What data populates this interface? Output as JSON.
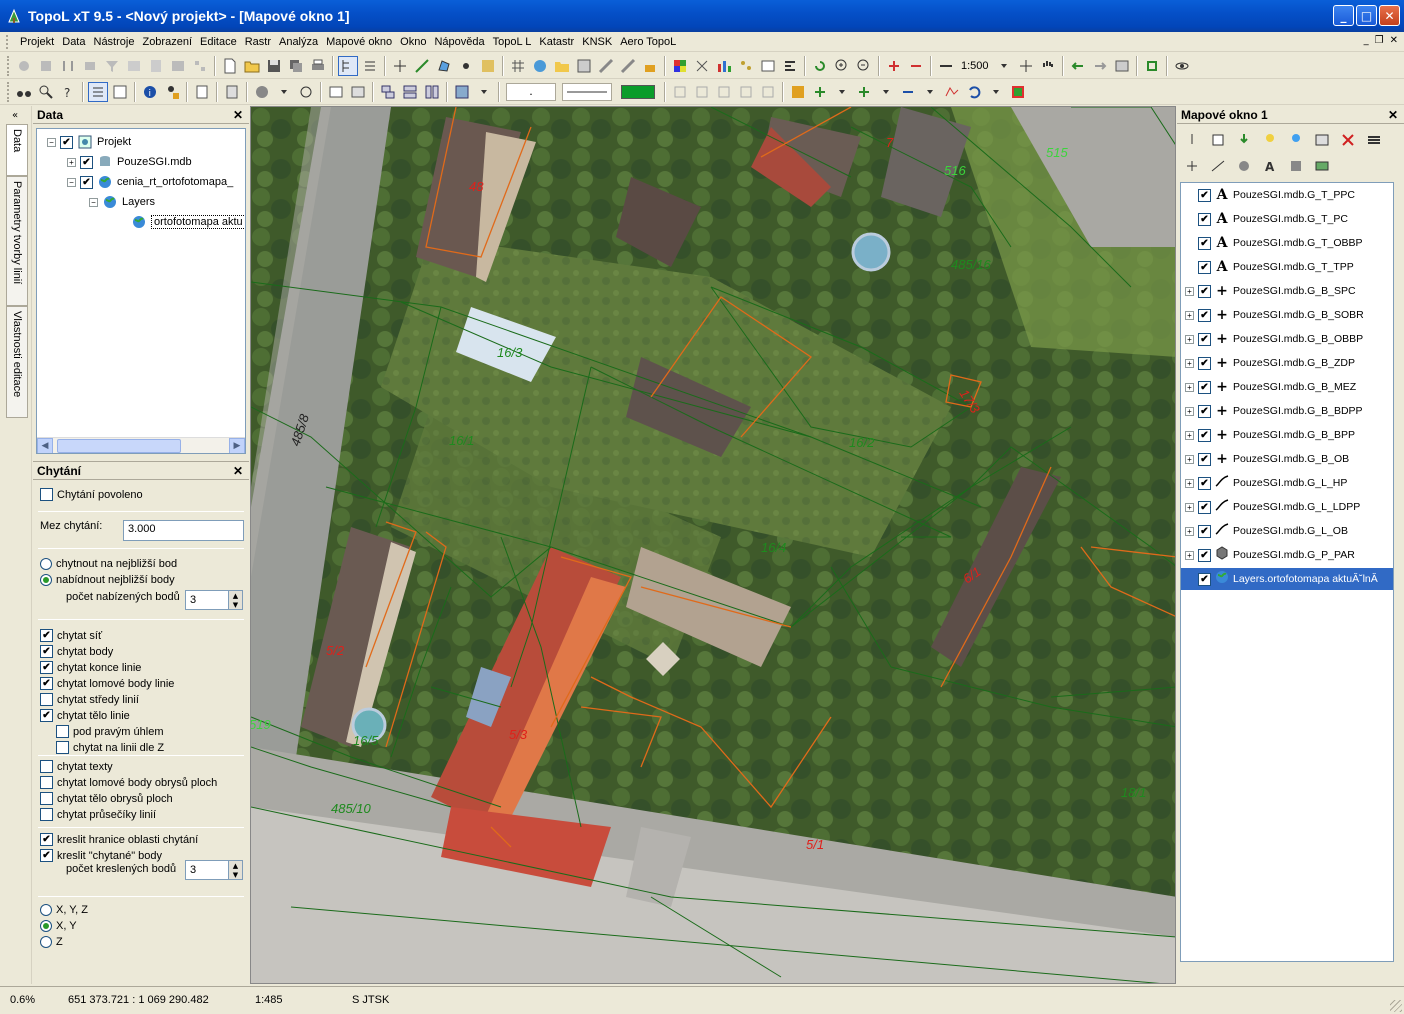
{
  "window": {
    "title": "TopoL xT 9.5 - <Nový projekt> - [Mapové okno 1]"
  },
  "menu": [
    "Projekt",
    "Data",
    "Nástroje",
    "Zobrazení",
    "Editace",
    "Rastr",
    "Analýza",
    "Mapové okno",
    "Okno",
    "Nápověda",
    "TopoL L",
    "Katastr",
    "KNSK",
    "Aero TopoL"
  ],
  "toolbar": {
    "scale": "1:500",
    "line_style": ".",
    "fill_color": "#0a9c2a"
  },
  "side_tabs": [
    "Data",
    "Parametry tvorby linií",
    "Vlastnosti editace"
  ],
  "data_panel": {
    "title": "Data",
    "tree": [
      {
        "label": "Projekt",
        "level": 0,
        "expander": "−",
        "checked": true
      },
      {
        "label": "PouzeSGI.mdb",
        "level": 1,
        "expander": "+",
        "checked": true
      },
      {
        "label": "cenia_rt_ortofotomapa_",
        "level": 1,
        "expander": "−",
        "checked": true
      },
      {
        "label": "Layers",
        "level": 2,
        "expander": "−"
      },
      {
        "label": "ortofotomapa aktu",
        "level": 3,
        "selected": true
      }
    ]
  },
  "snap_panel": {
    "title": "Chytání",
    "enabled_label": "Chytání povoleno",
    "enabled": false,
    "limit_label": "Mez chytání:",
    "limit_value": "3.000",
    "mode_nearest": "chytnout na nejbližší bod",
    "mode_offer": "nabídnout nejbližší body",
    "mode_selected": "offer",
    "offer_count_label": "počet nabízených bodů",
    "offer_count": "3",
    "options": [
      {
        "label": "chytat síť",
        "checked": true,
        "indent": false
      },
      {
        "label": "chytat body",
        "checked": true,
        "indent": false
      },
      {
        "label": "chytat konce linie",
        "checked": true,
        "indent": false
      },
      {
        "label": "chytat lomové body linie",
        "checked": true,
        "indent": false
      },
      {
        "label": "chytat středy linií",
        "checked": false,
        "indent": false
      },
      {
        "label": "chytat tělo linie",
        "checked": true,
        "indent": false
      },
      {
        "label": "pod pravým úhlem",
        "checked": false,
        "indent": true
      },
      {
        "label": "chytat na linii dle Z",
        "checked": false,
        "indent": true
      }
    ],
    "options2": [
      {
        "label": "chytat texty",
        "checked": false
      },
      {
        "label": "chytat lomové body obrysů ploch",
        "checked": false
      },
      {
        "label": "chytat tělo obrysů ploch",
        "checked": false
      },
      {
        "label": "chytat průsečíky linií",
        "checked": false
      }
    ],
    "draw_bounds_label": "kreslit hranice oblasti chytání",
    "draw_bounds": true,
    "draw_snapped_label": "kreslit \"chytané\" body",
    "draw_snapped": true,
    "draw_count_label": "počet kreslených bodů",
    "draw_count": "3",
    "coords": [
      {
        "label": "X, Y, Z",
        "selected": false
      },
      {
        "label": "X, Y",
        "selected": true
      },
      {
        "label": "Z",
        "selected": false
      }
    ]
  },
  "map": {
    "labels": [
      {
        "text": "48",
        "color": "#e0201a"
      },
      {
        "text": "7",
        "color": "#e0201a"
      },
      {
        "text": "516",
        "color": "#3cd43c"
      },
      {
        "text": "515",
        "color": "#3cd43c"
      },
      {
        "text": "485/16",
        "color": "#1e8a1e"
      },
      {
        "text": "16/3",
        "color": "#1e8a1e"
      },
      {
        "text": "17/3",
        "color": "#e0201a"
      },
      {
        "text": "16/1",
        "color": "#1e8a1e"
      },
      {
        "text": "16/2",
        "color": "#1e8a1e"
      },
      {
        "text": "485/8",
        "color": "#222222"
      },
      {
        "text": "16/4",
        "color": "#1e8a1e"
      },
      {
        "text": "6/1",
        "color": "#e0201a"
      },
      {
        "text": "5/2",
        "color": "#e0201a"
      },
      {
        "text": "519",
        "color": "#3cd43c"
      },
      {
        "text": "16/5",
        "color": "#1e8a1e"
      },
      {
        "text": "5/3",
        "color": "#e0201a"
      },
      {
        "text": "485/10",
        "color": "#1e8a1e"
      },
      {
        "text": "5/1",
        "color": "#e0201a"
      },
      {
        "text": "18/1",
        "color": "#1e8a1e"
      }
    ]
  },
  "map_window_panel": {
    "title": "Mapové okno 1",
    "layers": [
      {
        "label": "PouzeSGI.mdb.G_T_PPC",
        "symbol": "A",
        "expandable": false,
        "checked": true
      },
      {
        "label": "PouzeSGI.mdb.G_T_PC",
        "symbol": "A",
        "expandable": false,
        "checked": true
      },
      {
        "label": "PouzeSGI.mdb.G_T_OBBP",
        "symbol": "A",
        "expandable": false,
        "checked": true
      },
      {
        "label": "PouzeSGI.mdb.G_T_TPP",
        "symbol": "A",
        "expandable": false,
        "checked": true
      },
      {
        "label": "PouzeSGI.mdb.G_B_SPC",
        "symbol": "+",
        "expandable": true,
        "checked": true
      },
      {
        "label": "PouzeSGI.mdb.G_B_SOBR",
        "symbol": "+",
        "expandable": true,
        "checked": true
      },
      {
        "label": "PouzeSGI.mdb.G_B_OBBP",
        "symbol": "+",
        "expandable": true,
        "checked": true
      },
      {
        "label": "PouzeSGI.mdb.G_B_ZDP",
        "symbol": "+",
        "expandable": true,
        "checked": true
      },
      {
        "label": "PouzeSGI.mdb.G_B_MEZ",
        "symbol": "+",
        "expandable": true,
        "checked": true
      },
      {
        "label": "PouzeSGI.mdb.G_B_BDPP",
        "symbol": "+",
        "expandable": true,
        "checked": true
      },
      {
        "label": "PouzeSGI.mdb.G_B_BPP",
        "symbol": "+",
        "expandable": true,
        "checked": true
      },
      {
        "label": "PouzeSGI.mdb.G_B_OB",
        "symbol": "+",
        "expandable": true,
        "checked": true
      },
      {
        "label": "PouzeSGI.mdb.G_L_HP",
        "symbol": "line",
        "expandable": true,
        "checked": true
      },
      {
        "label": "PouzeSGI.mdb.G_L_LDPP",
        "symbol": "line",
        "expandable": true,
        "checked": true
      },
      {
        "label": "PouzeSGI.mdb.G_L_OB",
        "symbol": "line",
        "expandable": true,
        "checked": true
      },
      {
        "label": "PouzeSGI.mdb.G_P_PAR",
        "symbol": "poly",
        "expandable": true,
        "checked": true
      },
      {
        "label": "Layers.ortofotomapa aktuĂ˘lnĂ­",
        "symbol": "globe",
        "expandable": false,
        "checked": true,
        "selected": true
      }
    ]
  },
  "status": {
    "progress": "0.6%",
    "coords": "651 373.721 : 1 069 290.482",
    "scale": "1:485",
    "crs": "S JTSK"
  }
}
